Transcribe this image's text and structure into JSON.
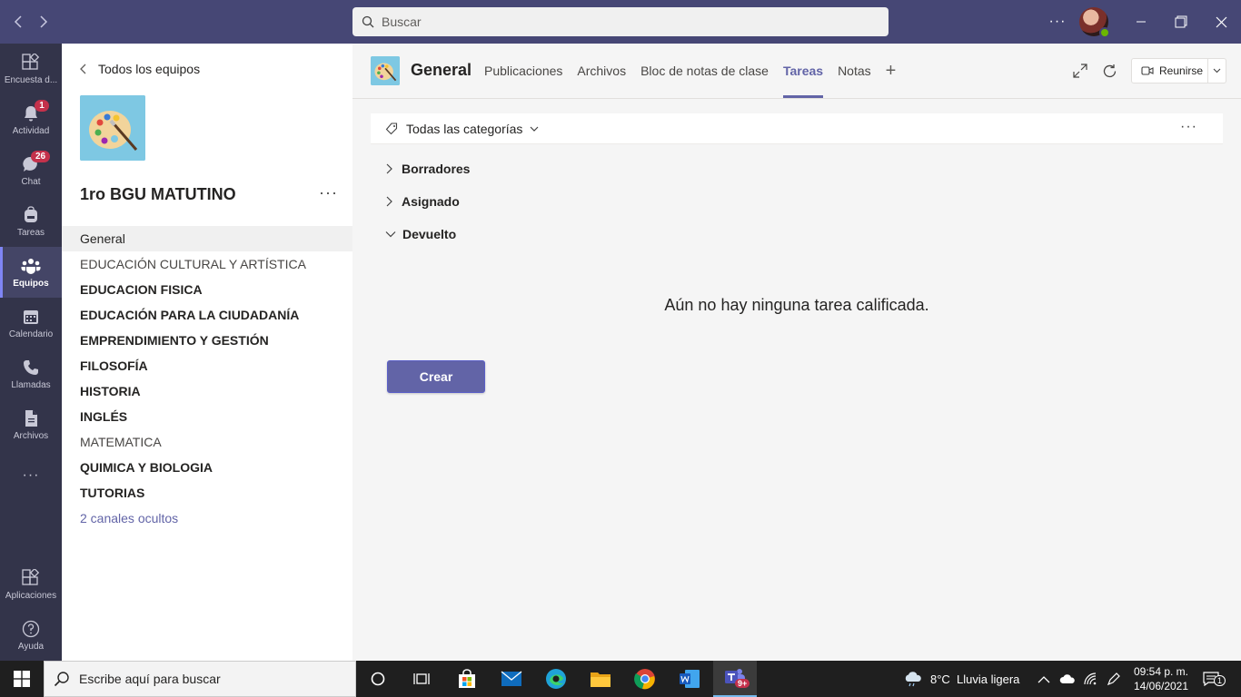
{
  "titlebar": {
    "search_placeholder": "Buscar",
    "more_label": "···"
  },
  "rail": {
    "items": [
      {
        "label": "Encuesta d...",
        "icon": "apps-grid-icon"
      },
      {
        "label": "Actividad",
        "icon": "bell-icon",
        "badge": "1"
      },
      {
        "label": "Chat",
        "icon": "chat-icon",
        "badge": "26"
      },
      {
        "label": "Tareas",
        "icon": "backpack-icon"
      },
      {
        "label": "Equipos",
        "icon": "teams-icon",
        "active": true
      },
      {
        "label": "Calendario",
        "icon": "calendar-icon"
      },
      {
        "label": "Llamadas",
        "icon": "phone-icon"
      },
      {
        "label": "Archivos",
        "icon": "file-icon"
      }
    ],
    "more_label": "···",
    "apps_label": "Aplicaciones",
    "help_label": "Ayuda"
  },
  "panel": {
    "back_label": "Todos los equipos",
    "team_name": "1ro BGU MATUTINO",
    "more_label": "···",
    "channels": [
      {
        "label": "General"
      },
      {
        "label": "EDUCACIÓN CULTURAL Y ARTÍSTICA"
      },
      {
        "label": "EDUCACION FISICA"
      },
      {
        "label": "EDUCACIÓN PARA LA CIUDADANÍA"
      },
      {
        "label": "EMPRENDIMIENTO Y GESTIÓN"
      },
      {
        "label": "FILOSOFÍA"
      },
      {
        "label": "HISTORIA"
      },
      {
        "label": "INGLÉS"
      },
      {
        "label": "MATEMATICA"
      },
      {
        "label": "QUIMICA Y BIOLOGIA"
      },
      {
        "label": "TUTORIAS"
      },
      {
        "label": "2 canales ocultos"
      }
    ]
  },
  "header": {
    "channel_title": "General",
    "tabs": [
      {
        "label": "Publicaciones"
      },
      {
        "label": "Archivos"
      },
      {
        "label": "Bloc de notas de clase"
      },
      {
        "label": "Tareas"
      },
      {
        "label": "Notas"
      }
    ],
    "add_tab": "+",
    "meet_label": "Reunirse"
  },
  "assignments": {
    "filter_label": "Todas las categorías",
    "more_label": "···",
    "sections": [
      {
        "label": "Borradores"
      },
      {
        "label": "Asignado"
      },
      {
        "label": "Devuelto"
      }
    ],
    "empty_message": "Aún no hay ninguna tarea calificada.",
    "create_label": "Crear"
  },
  "taskbar": {
    "search_placeholder": "Escribe aquí para buscar",
    "weather": "8°C  Lluvia ligera",
    "time": "09:54 p. m.",
    "date": "14/06/2021",
    "teams_badge": "9+",
    "notification_count": "1"
  },
  "colors": {
    "titlebar": "#464775",
    "rail": "#33344a",
    "accent": "#6264a7"
  }
}
